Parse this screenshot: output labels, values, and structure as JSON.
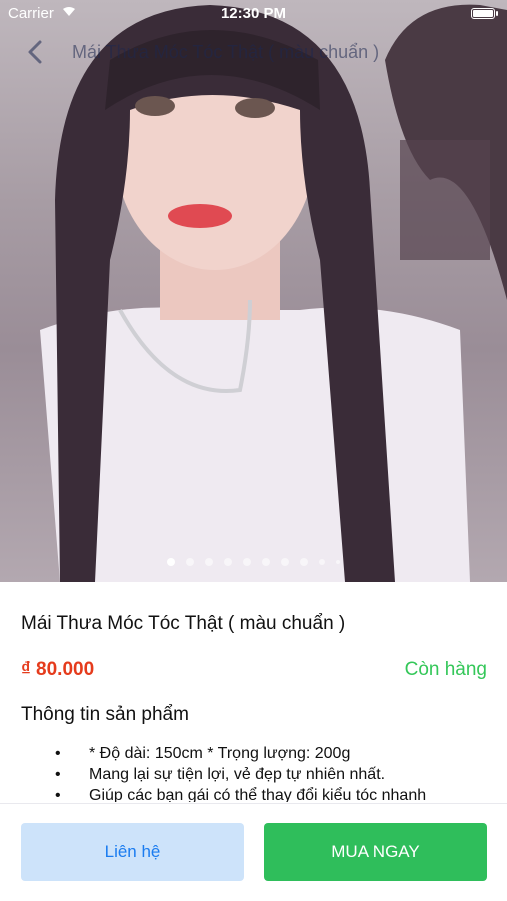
{
  "status_bar": {
    "carrier": "Carrier",
    "time": "12:30 PM"
  },
  "nav": {
    "title": "Mái Thưa Móc Tóc Thật ( màu chuẩn )"
  },
  "carousel": {
    "total_images": 10,
    "current_index": 0
  },
  "product": {
    "name": "Mái Thưa Móc Tóc Thật ( màu chuẩn )",
    "price": "₫ 80.000",
    "stock": "Còn hàng",
    "section_title": "Thông tin sản phẩm",
    "description": [
      "* Độ dài: 150cm * Trọng lượng: 200g",
      "Mang lại sự tiện lợi, vẻ đẹp tự nhiên nhất.",
      "Giúp các bạn gái có thể thay đổi kiểu tóc nhanh"
    ],
    "bullet": "•"
  },
  "actions": {
    "contact_label": "Liên hệ",
    "buy_label": "MUA NGAY"
  },
  "colors": {
    "price": "#e53b1c",
    "stock": "#34c759",
    "buy": "#2fbe5b",
    "contact_bg": "#cde3fa",
    "contact_text": "#1b7cf0"
  }
}
